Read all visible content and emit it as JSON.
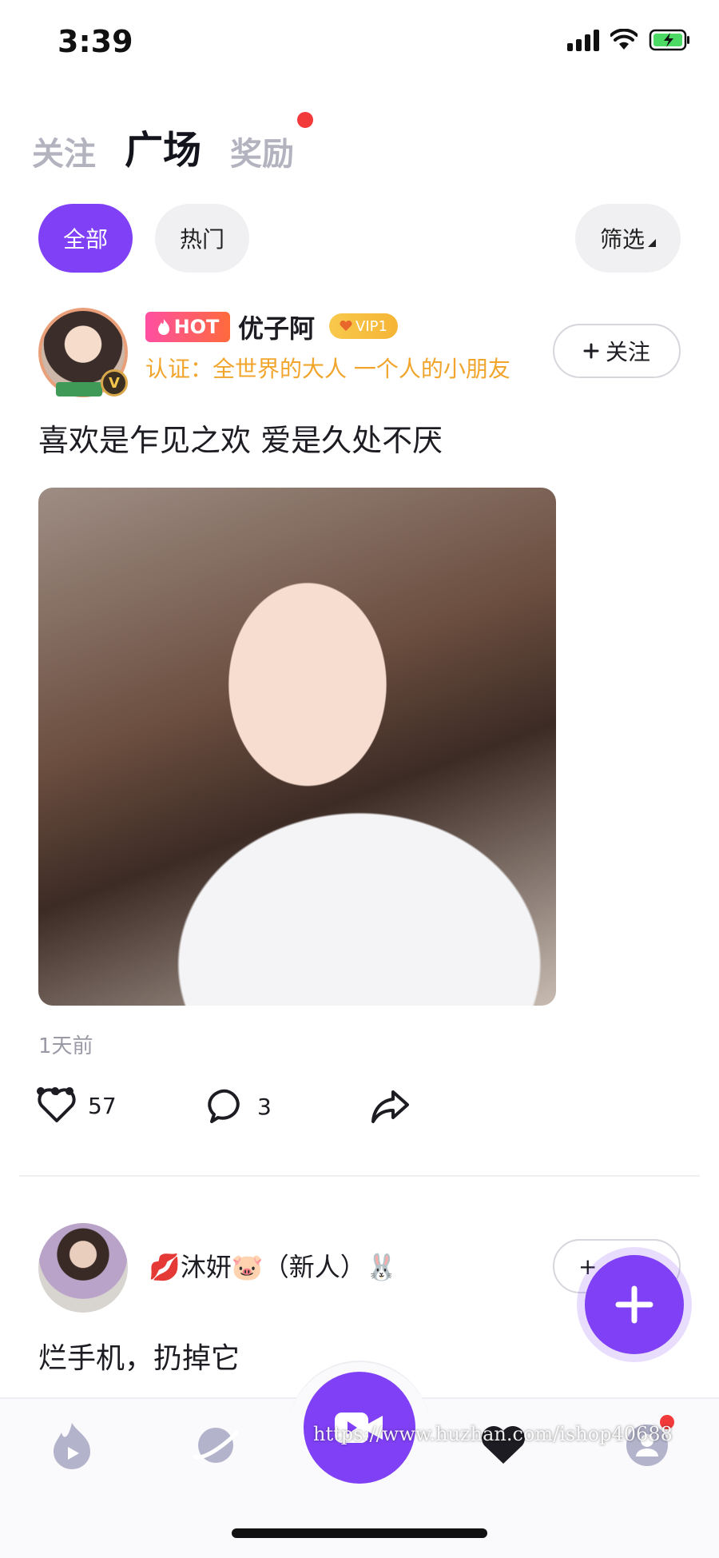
{
  "status_bar": {
    "time": "3:39",
    "battery_color": "#4cd964"
  },
  "top_tabs": [
    {
      "label": "关注",
      "active": false
    },
    {
      "label": "广场",
      "active": true
    },
    {
      "label": "奖励",
      "active": false,
      "has_dot": true
    }
  ],
  "filters": {
    "all": "全部",
    "hot": "热门",
    "filter": "筛选"
  },
  "posts": [
    {
      "hot_badge": "HOT",
      "username": "优子阿",
      "vip": "VIP1",
      "certification": "认证：全世界的大人 一个人的小朋友",
      "follow_label": "关注",
      "text": "喜欢是乍见之欢 爱是久处不厌",
      "time": "1天前",
      "likes": "57",
      "comments": "3"
    },
    {
      "username": "💋沐妍🐷（新人）🐰",
      "follow_label": "+",
      "text": "烂手机，扔掉它"
    }
  ],
  "watermark": "https://www.huzhan.com/ishop40688",
  "colors": {
    "accent": "#8040f6",
    "hot_gradient_start": "#ff4fa2",
    "cert_text": "#f1a52c",
    "notification_dot": "#f23a3a"
  },
  "icons": {
    "nav": [
      "flame-icon",
      "planet-icon",
      "video-camera-icon",
      "heart-icon",
      "profile-icon"
    ],
    "actions": [
      "heart-outline-icon",
      "comment-icon",
      "share-icon",
      "more-icon"
    ]
  }
}
